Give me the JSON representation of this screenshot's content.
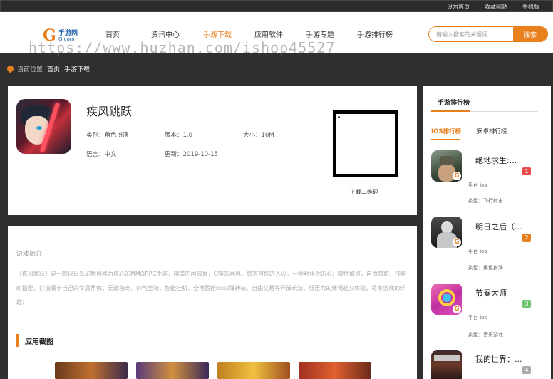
{
  "topbar": {
    "left_mark": "|",
    "links": [
      "设为首页",
      "收藏网站",
      "手机版"
    ]
  },
  "header": {
    "logo_letter": "G",
    "logo_text": "手游网",
    "logo_url": "G.com",
    "nav": [
      {
        "label": "首页",
        "active": false
      },
      {
        "label": "资讯中心",
        "active": false
      },
      {
        "label": "手游下载",
        "active": true
      },
      {
        "label": "应用软件",
        "active": false
      },
      {
        "label": "手游专题",
        "active": false
      },
      {
        "label": "手游排行榜",
        "active": false
      }
    ],
    "search": {
      "placeholder": "请输入搜索的关键词",
      "button": "搜索"
    },
    "watermark": "https://www.huzhan.com/ishop45527"
  },
  "breadcrumb": {
    "label": "当前位置",
    "items": [
      "首页",
      "手游下载"
    ]
  },
  "game": {
    "title": "疾风跳跃",
    "category": "类别：角色扮演",
    "version": "版本：1.0",
    "size": "大小：10M",
    "language": "语言：中文",
    "updated": "更新：2019-10-15",
    "qr_label": "下载二维码"
  },
  "description": {
    "title": "游戏简介",
    "text": "《疾风跳跃》是一款以日系幻想风格为核心的MMORPG手游，精美的画效果，Q萌的画风，憨态可掬的人设，一秒融化你的心；属性加点，自由转职，技能时搭配，打造属于自己的专属角色；无敌萌宠，帅气坐骑，智能挂机，全地图抢boss爆神装，自由交易等开放玩法，低压力的休闲社交体验，尽享游戏的乐趣！",
    "screenshots_title": "应用截图"
  },
  "sidebar": {
    "title": "手游排行榜",
    "tabs": [
      "IOS排行榜",
      "安卓排行榜"
    ],
    "items": [
      {
        "name": "绝地求生:...",
        "rank": "1",
        "badge_color": "#e84c4c",
        "platform": "平台 ios",
        "type": "类型：飞行射击"
      },
      {
        "name": "明日之后（...",
        "rank": "2",
        "badge_color": "#e8801e",
        "platform": "平台 ios",
        "type": "类型：角色扮演"
      },
      {
        "name": "节奏大师",
        "rank": "3",
        "badge_color": "#6cc46c",
        "platform": "平台 ios",
        "type": "类型：音乐游戏"
      },
      {
        "name": "我的世界：...",
        "rank": "4",
        "badge_color": "#aaaaaa",
        "platform": "",
        "type": ""
      }
    ]
  }
}
